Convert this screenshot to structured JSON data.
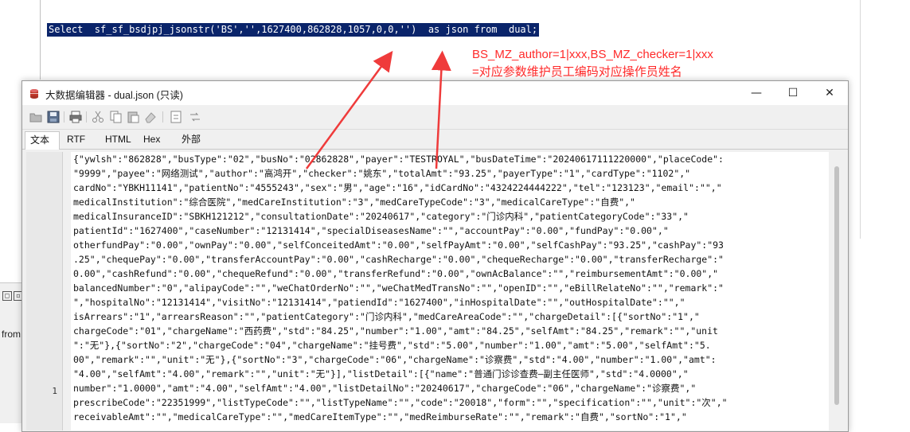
{
  "sql_editor": {
    "query": "Select  sf_sf_bsdjpj_jsonstr('BS','',1627400,862828,1057,0,0,'')  as json from  dual;"
  },
  "annotation": {
    "line1": "BS_MZ_author=1|xxx,BS_MZ_checker=1|xxx",
    "line2": "=对应参数维护员工编码对应操作员姓名",
    "color": "#ff2a2a"
  },
  "background_stub": {
    "text": "from"
  },
  "window": {
    "title": "大数据编辑器 - dual.json (只读)",
    "minimize_glyph": "—",
    "maximize_glyph": "☐",
    "close_glyph": "✕"
  },
  "toolbar": {
    "icons": [
      "open-icon",
      "save-icon",
      "print-icon",
      "cut-icon",
      "copy-icon",
      "paste-icon",
      "eraser-icon",
      "convert-icon",
      "compare-icon"
    ]
  },
  "tabs": [
    {
      "label": "文本"
    },
    {
      "label": "RTF"
    },
    {
      "label": "HTML"
    },
    {
      "label": "Hex"
    },
    {
      "label": "外部"
    }
  ],
  "editor": {
    "line_number": "1",
    "lines": [
      "{\"ywlsh\":\"862828\",\"busType\":\"02\",\"busNo\":\"02862828\",\"payer\":\"TESTROYAL\",\"busDateTime\":\"20240617111220000\",\"placeCode\":",
      "\"9999\",\"payee\":\"网络测试\",\"author\":\"高鸿开\",\"checker\":\"姚东\",\"totalAmt\":\"93.25\",\"payerType\":\"1\",\"cardType\":\"1102\",\"",
      "cardNo\":\"YBKH11141\",\"patientNo\":\"4555243\",\"sex\":\"男\",\"age\":\"16\",\"idCardNo\":\"4324224444222\",\"tel\":\"123123\",\"email\":\"\",\"",
      "medicalInstitution\":\"综合医院\",\"medCareInstitution\":\"3\",\"medCareTypeCode\":\"3\",\"medicalCareType\":\"自费\",\"",
      "medicalInsuranceID\":\"SBKH121212\",\"consultationDate\":\"20240617\",\"category\":\"门诊内科\",\"patientCategoryCode\":\"33\",\"",
      "patientId\":\"1627400\",\"caseNumber\":\"12131414\",\"specialDiseasesName\":\"\",\"accountPay\":\"0.00\",\"fundPay\":\"0.00\",\"",
      "otherfundPay\":\"0.00\",\"ownPay\":\"0.00\",\"selfConceitedAmt\":\"0.00\",\"selfPayAmt\":\"0.00\",\"selfCashPay\":\"93.25\",\"cashPay\":\"93",
      ".25\",\"chequePay\":\"0.00\",\"transferAccountPay\":\"0.00\",\"cashRecharge\":\"0.00\",\"chequeRecharge\":\"0.00\",\"transferRecharge\":\"",
      "0.00\",\"cashRefund\":\"0.00\",\"chequeRefund\":\"0.00\",\"transferRefund\":\"0.00\",\"ownAcBalance\":\"\",\"reimbursementAmt\":\"0.00\",\"",
      "balancedNumber\":\"0\",\"alipayCode\":\"\",\"weChatOrderNo\":\"\",\"weChatMedTransNo\":\"\",\"openID\":\"\",\"eBillRelateNo\":\"\",\"remark\":\"",
      "\",\"hospitalNo\":\"12131414\",\"visitNo\":\"12131414\",\"patiendId\":\"1627400\",\"inHospitalDate\":\"\",\"outHospitalDate\":\"\",\"",
      "isArrears\":\"1\",\"arrearsReason\":\"\",\"patientCategory\":\"门诊内科\",\"medCareAreaCode\":\"\",\"chargeDetail\":[{\"sortNo\":\"1\",\"",
      "chargeCode\":\"01\",\"chargeName\":\"西药费\",\"std\":\"84.25\",\"number\":\"1.00\",\"amt\":\"84.25\",\"selfAmt\":\"84.25\",\"remark\":\"\",\"unit",
      "\":\"无\"},{\"sortNo\":\"2\",\"chargeCode\":\"04\",\"chargeName\":\"挂号费\",\"std\":\"5.00\",\"number\":\"1.00\",\"amt\":\"5.00\",\"selfAmt\":\"5.",
      "00\",\"remark\":\"\",\"unit\":\"无\"},{\"sortNo\":\"3\",\"chargeCode\":\"06\",\"chargeName\":\"诊察费\",\"std\":\"4.00\",\"number\":\"1.00\",\"amt\":",
      "\"4.00\",\"selfAmt\":\"4.00\",\"remark\":\"\",\"unit\":\"无\"}],\"listDetail\":[{\"name\":\"普通门诊诊查费—副主任医师\",\"std\":\"4.0000\",\"",
      "number\":\"1.0000\",\"amt\":\"4.00\",\"selfAmt\":\"4.00\",\"listDetailNo\":\"20240617\",\"chargeCode\":\"06\",\"chargeName\":\"诊察费\",\"",
      "prescribeCode\":\"22351999\",\"listTypeCode\":\"\",\"listTypeName\":\"\",\"code\":\"20018\",\"form\":\"\",\"specification\":\"\",\"unit\":\"次\",\"",
      "receivableAmt\":\"\",\"medicalCareType\":\"\",\"medCareItemType\":\"\",\"medReimburseRate\":\"\",\"remark\":\"自费\",\"sortNo\":\"1\",\""
    ]
  }
}
